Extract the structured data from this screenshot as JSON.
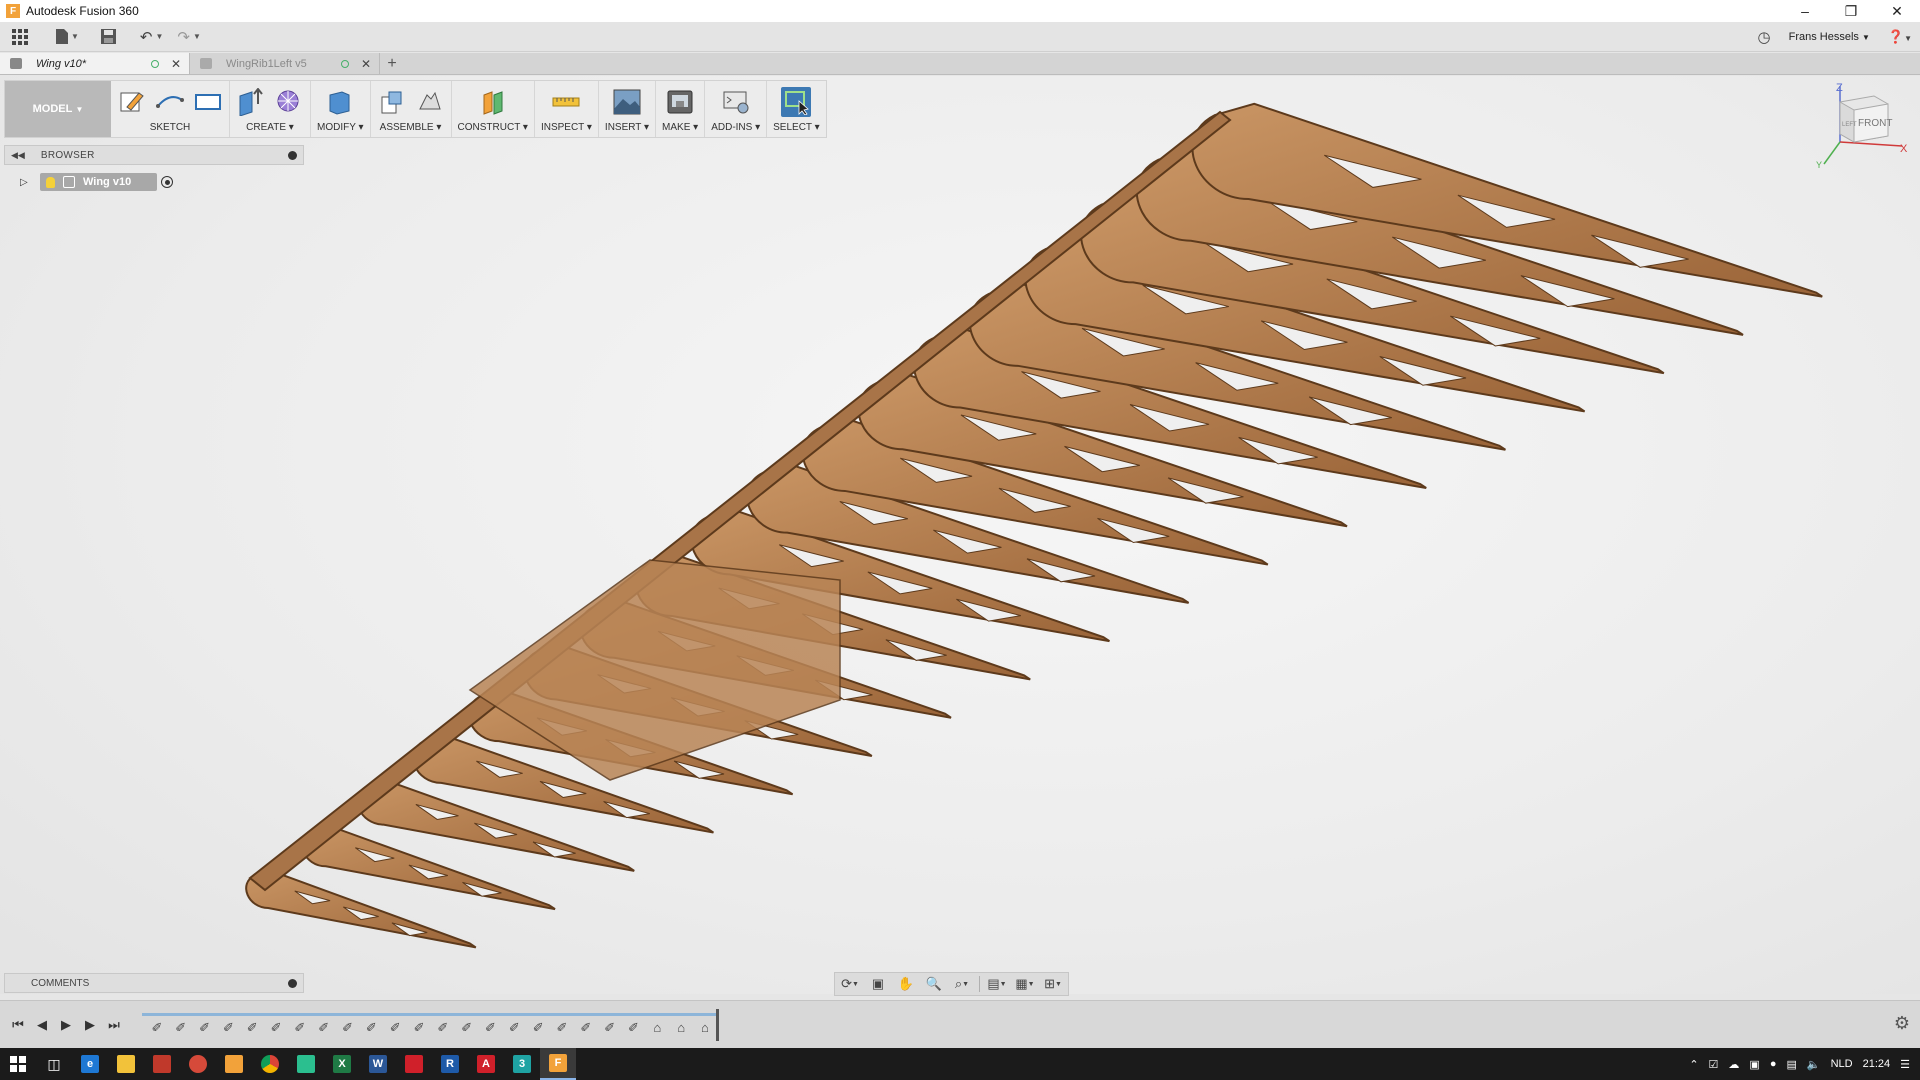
{
  "window": {
    "title": "Autodesk Fusion 360",
    "app_icon_letter": "F"
  },
  "quick_access": {
    "user_name": "Frans Hessels"
  },
  "tabs": [
    {
      "label": "Wing v10*",
      "active": true
    },
    {
      "label": "WingRib1Left v5",
      "active": false
    }
  ],
  "toolbar": {
    "mode": "MODEL",
    "groups": [
      {
        "label": "SKETCH"
      },
      {
        "label": "CREATE"
      },
      {
        "label": "MODIFY"
      },
      {
        "label": "ASSEMBLE"
      },
      {
        "label": "CONSTRUCT"
      },
      {
        "label": "INSPECT"
      },
      {
        "label": "INSERT"
      },
      {
        "label": "MAKE"
      },
      {
        "label": "ADD-INS"
      },
      {
        "label": "SELECT"
      }
    ]
  },
  "browser": {
    "title": "BROWSER",
    "root": "Wing v10"
  },
  "comments": {
    "title": "COMMENTS"
  },
  "viewcube": {
    "face": "FRONT",
    "side": "LEFT",
    "axis_x": "X",
    "axis_z": "Z",
    "axis_y": "Y"
  },
  "taskbar": {
    "lang": "NLD",
    "time": "21:24"
  },
  "colors": {
    "wood": "#b07a4a",
    "wood_dark": "#6e4424",
    "select_blue": "#3d79b3",
    "accent_orange": "#f2a23a"
  }
}
